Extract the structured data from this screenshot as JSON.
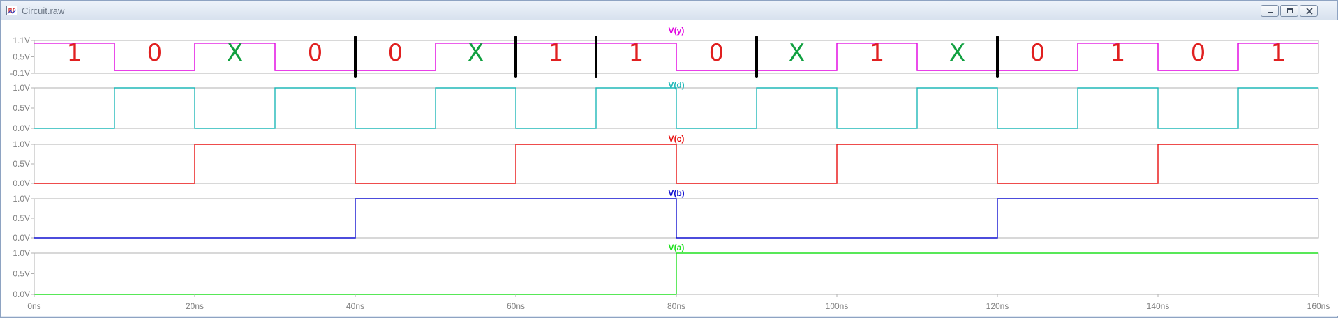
{
  "window": {
    "title": "Circuit.raw"
  },
  "icons": {
    "app": "waveform-app-icon",
    "minimize": "minimize-icon",
    "maximize": "maximize-icon",
    "close": "close-icon"
  },
  "colors": {
    "y": "#e000e0",
    "d": "#20b8b8",
    "c": "#e81010",
    "b": "#1010d0",
    "a": "#20e020",
    "annotation_red": "#e02020",
    "annotation_green": "#10a040",
    "grid": "#b0b0b0",
    "axis_text": "#808080"
  },
  "x_axis": {
    "labels": [
      "0ns",
      "20ns",
      "40ns",
      "60ns",
      "80ns",
      "100ns",
      "120ns",
      "140ns",
      "160ns"
    ]
  },
  "panes": [
    {
      "id": "y",
      "label": "V(y)",
      "ticks": [
        "1.1V",
        "0.5V",
        "-0.1V"
      ]
    },
    {
      "id": "d",
      "label": "V(d)",
      "ticks": [
        "1.0V",
        "0.5V",
        "0.0V"
      ]
    },
    {
      "id": "c",
      "label": "V(c)",
      "ticks": [
        "1.0V",
        "0.5V",
        "0.0V"
      ]
    },
    {
      "id": "b",
      "label": "V(b)",
      "ticks": [
        "1.0V",
        "0.5V",
        "0.0V"
      ]
    },
    {
      "id": "a",
      "label": "V(a)",
      "ticks": [
        "1.0V",
        "0.5V",
        "0.0V"
      ]
    }
  ],
  "chart_data": {
    "type": "line",
    "x_unit": "ns",
    "xlim": [
      0,
      160
    ],
    "grid": false,
    "series": [
      {
        "name": "V(y)",
        "ylim": [
          -0.1,
          1.1
        ],
        "points": [
          [
            0,
            1
          ],
          [
            10,
            1
          ],
          [
            10,
            0
          ],
          [
            20,
            0
          ],
          [
            20,
            1
          ],
          [
            30,
            1
          ],
          [
            30,
            0
          ],
          [
            50,
            0
          ],
          [
            50,
            1
          ],
          [
            80,
            1
          ],
          [
            80,
            0
          ],
          [
            100,
            0
          ],
          [
            100,
            1
          ],
          [
            110,
            1
          ],
          [
            110,
            0
          ],
          [
            130,
            0
          ],
          [
            130,
            1
          ],
          [
            140,
            1
          ],
          [
            140,
            0
          ],
          [
            150,
            0
          ],
          [
            150,
            1
          ],
          [
            160,
            1
          ]
        ]
      },
      {
        "name": "V(d)",
        "ylim": [
          0,
          1
        ],
        "points": [
          [
            0,
            0
          ],
          [
            10,
            0
          ],
          [
            10,
            1
          ],
          [
            20,
            1
          ],
          [
            20,
            0
          ],
          [
            30,
            0
          ],
          [
            30,
            1
          ],
          [
            40,
            1
          ],
          [
            40,
            0
          ],
          [
            50,
            0
          ],
          [
            50,
            1
          ],
          [
            60,
            1
          ],
          [
            60,
            0
          ],
          [
            70,
            0
          ],
          [
            70,
            1
          ],
          [
            80,
            1
          ],
          [
            80,
            0
          ],
          [
            90,
            0
          ],
          [
            90,
            1
          ],
          [
            100,
            1
          ],
          [
            100,
            0
          ],
          [
            110,
            0
          ],
          [
            110,
            1
          ],
          [
            120,
            1
          ],
          [
            120,
            0
          ],
          [
            130,
            0
          ],
          [
            130,
            1
          ],
          [
            140,
            1
          ],
          [
            140,
            0
          ],
          [
            150,
            0
          ],
          [
            150,
            1
          ],
          [
            160,
            1
          ]
        ]
      },
      {
        "name": "V(c)",
        "ylim": [
          0,
          1
        ],
        "points": [
          [
            0,
            0
          ],
          [
            20,
            0
          ],
          [
            20,
            1
          ],
          [
            40,
            1
          ],
          [
            40,
            0
          ],
          [
            60,
            0
          ],
          [
            60,
            1
          ],
          [
            80,
            1
          ],
          [
            80,
            0
          ],
          [
            100,
            0
          ],
          [
            100,
            1
          ],
          [
            120,
            1
          ],
          [
            120,
            0
          ],
          [
            140,
            0
          ],
          [
            140,
            1
          ],
          [
            160,
            1
          ]
        ]
      },
      {
        "name": "V(b)",
        "ylim": [
          0,
          1
        ],
        "points": [
          [
            0,
            0
          ],
          [
            40,
            0
          ],
          [
            40,
            1
          ],
          [
            80,
            1
          ],
          [
            80,
            0
          ],
          [
            120,
            0
          ],
          [
            120,
            1
          ],
          [
            160,
            1
          ]
        ]
      },
      {
        "name": "V(a)",
        "ylim": [
          0,
          1
        ],
        "points": [
          [
            0,
            0
          ],
          [
            80,
            0
          ],
          [
            80,
            1
          ],
          [
            160,
            1
          ]
        ]
      }
    ]
  },
  "annotations": {
    "marks": [
      {
        "x": 5,
        "text": "1",
        "color_key": "annotation_red"
      },
      {
        "x": 15,
        "text": "0",
        "color_key": "annotation_red"
      },
      {
        "x": 25,
        "text": "X",
        "color_key": "annotation_green"
      },
      {
        "x": 35,
        "text": "0",
        "color_key": "annotation_red"
      },
      {
        "x": 45,
        "text": "0",
        "color_key": "annotation_red"
      },
      {
        "x": 55,
        "text": "X",
        "color_key": "annotation_green"
      },
      {
        "x": 65,
        "text": "1",
        "color_key": "annotation_red"
      },
      {
        "x": 75,
        "text": "1",
        "color_key": "annotation_red"
      },
      {
        "x": 85,
        "text": "0",
        "color_key": "annotation_red"
      },
      {
        "x": 95,
        "text": "X",
        "color_key": "annotation_green"
      },
      {
        "x": 105,
        "text": "1",
        "color_key": "annotation_red"
      },
      {
        "x": 115,
        "text": "X",
        "color_key": "annotation_green"
      },
      {
        "x": 125,
        "text": "0",
        "color_key": "annotation_red"
      },
      {
        "x": 135,
        "text": "1",
        "color_key": "annotation_red"
      },
      {
        "x": 145,
        "text": "0",
        "color_key": "annotation_red"
      },
      {
        "x": 155,
        "text": "1",
        "color_key": "annotation_red"
      }
    ],
    "dividers": [
      40,
      60,
      70,
      90,
      120
    ]
  }
}
